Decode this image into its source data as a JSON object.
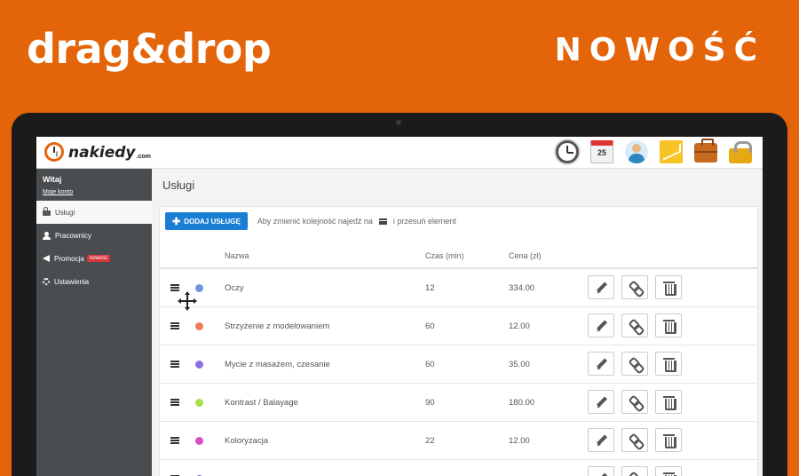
{
  "banner": {
    "left": "drag&drop",
    "right": "NOWOŚĆ"
  },
  "app": {
    "logo_text": "nakiedy",
    "logo_tld": ".com"
  },
  "topbar": {
    "icons": [
      "clock-icon",
      "calendar-icon",
      "user-icon",
      "chart-icon",
      "briefcase-icon",
      "lock-icon"
    ],
    "calendar_day": "25"
  },
  "sidebar": {
    "welcome": "Witaj",
    "account_link": "Moje konto",
    "items": [
      {
        "label": "Usługi",
        "icon": "lock-icon",
        "active": true
      },
      {
        "label": "Pracownicy",
        "icon": "user-icon"
      },
      {
        "label": "Promocja",
        "icon": "megaphone-icon",
        "badge": "nowość"
      },
      {
        "label": "Ustawienia",
        "icon": "gear-icon"
      }
    ]
  },
  "main": {
    "title": "Usługi",
    "add_button": "DODAJ USŁUGĘ",
    "hint_before": "Aby zmienić kolejność najedź na",
    "hint_after": "i przesuń element",
    "columns": {
      "name": "Nazwa",
      "time": "Czas (min)",
      "price": "Cena (zł)"
    },
    "rows": [
      {
        "color": "#6f95e0",
        "name": "Oczy",
        "time": "12",
        "price": "334.00"
      },
      {
        "color": "#ee7a5c",
        "name": "Strzyżenie z modelowaniem",
        "time": "60",
        "price": "12.00"
      },
      {
        "color": "#8c6ee6",
        "name": "Mycie z masażem, czesanie",
        "time": "60",
        "price": "35.00"
      },
      {
        "color": "#a6e04e",
        "name": "Kontrast / Balayage",
        "time": "90",
        "price": "180.00"
      },
      {
        "color": "#d64fc4",
        "name": "Koloryzacja",
        "time": "22",
        "price": "12.00"
      }
    ]
  }
}
